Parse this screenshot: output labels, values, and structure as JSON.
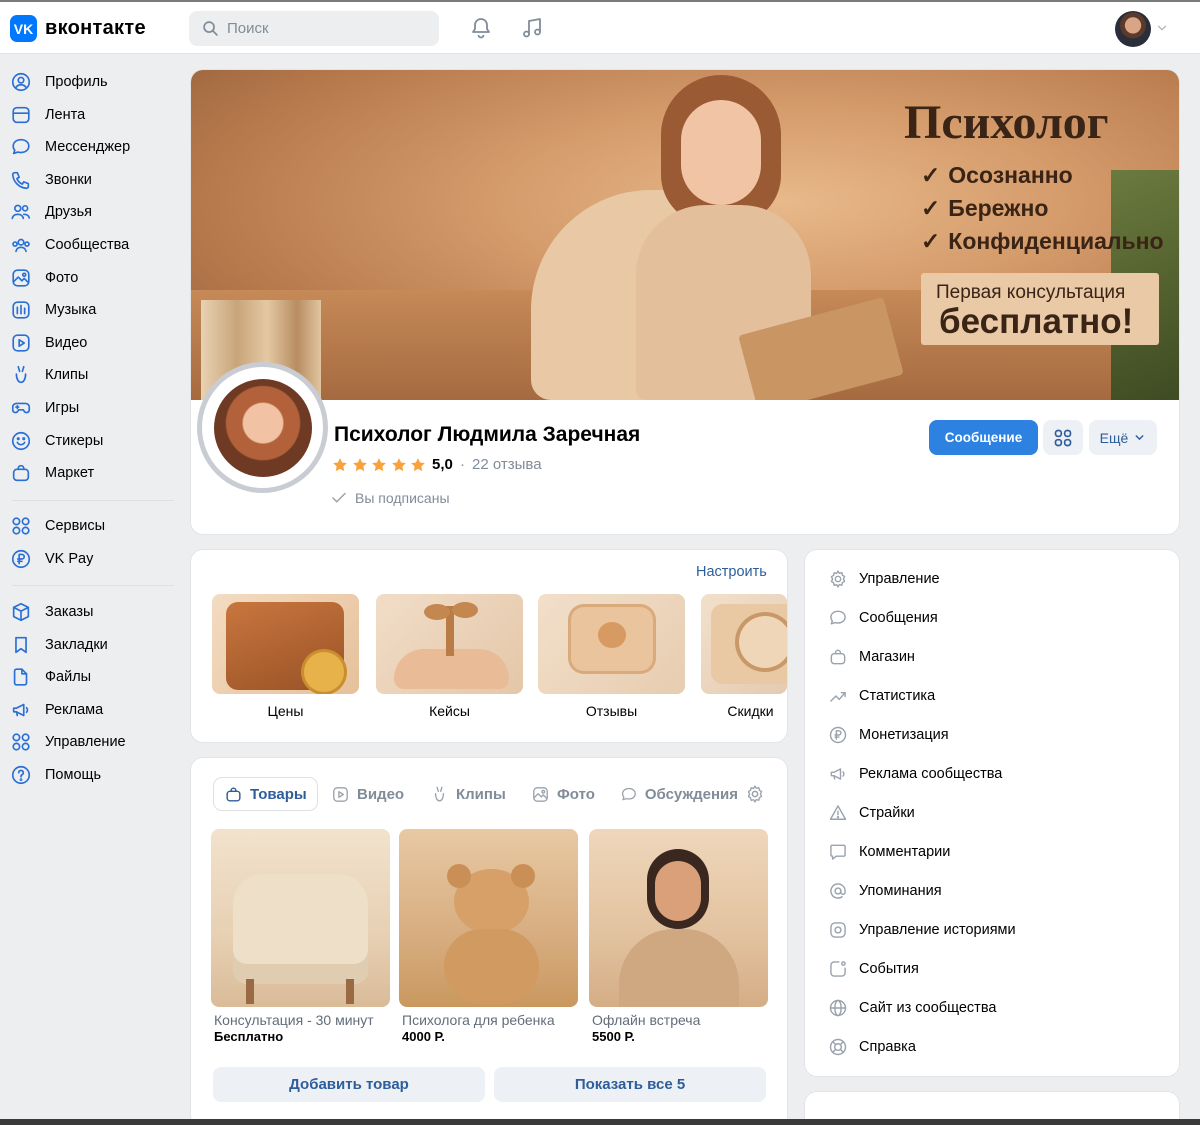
{
  "header": {
    "logo_mark": "VK",
    "logo_text": "вконтакте",
    "search_placeholder": "Поиск",
    "icons": [
      "search-icon",
      "bell-icon",
      "music-note-icon",
      "chevron-down-icon"
    ]
  },
  "sidebar": {
    "items": [
      {
        "label": "Профиль",
        "icon": "user-circle-icon"
      },
      {
        "label": "Лента",
        "icon": "feed-icon"
      },
      {
        "label": "Мессенджер",
        "icon": "chat-bubble-icon"
      },
      {
        "label": "Звонки",
        "icon": "phone-icon"
      },
      {
        "label": "Друзья",
        "icon": "friends-icon"
      },
      {
        "label": "Сообщества",
        "icon": "communities-icon"
      },
      {
        "label": "Фото",
        "icon": "photo-icon"
      },
      {
        "label": "Музыка",
        "icon": "music-icon"
      },
      {
        "label": "Видео",
        "icon": "video-icon"
      },
      {
        "label": "Клипы",
        "icon": "clips-icon"
      },
      {
        "label": "Игры",
        "icon": "gamepad-icon"
      },
      {
        "label": "Стикеры",
        "icon": "smile-icon"
      },
      {
        "label": "Маркет",
        "icon": "bag-icon"
      }
    ],
    "items2": [
      {
        "label": "Сервисы",
        "icon": "grid-icon"
      },
      {
        "label": "VK Pay",
        "icon": "ruble-circle-icon"
      }
    ],
    "items3": [
      {
        "label": "Заказы",
        "icon": "box-icon"
      },
      {
        "label": "Закладки",
        "icon": "bookmark-icon"
      },
      {
        "label": "Файлы",
        "icon": "file-icon"
      },
      {
        "label": "Реклама",
        "icon": "megaphone-icon"
      },
      {
        "label": "Управление",
        "icon": "grid-icon"
      },
      {
        "label": "Помощь",
        "icon": "question-circle-icon"
      }
    ]
  },
  "cover": {
    "title": "Психолог",
    "checks": [
      "Осознанно",
      "Бережно",
      "Конфиденциально"
    ],
    "promo_line1": "Первая консультация",
    "promo_line2": "бесплатно!"
  },
  "profile": {
    "name": "Психолог Людмила Заречная",
    "rating": "5,0",
    "rating_stars": 5,
    "separator": "·",
    "reviews": "22 отзыва",
    "subscribed": "Вы подписаны",
    "message_button": "Сообщение",
    "more_button": "Ещё",
    "colors": {
      "primary": "#2d81e0",
      "star": "#f9a23c",
      "link": "#2d5d9b"
    }
  },
  "tiles": {
    "configure": "Настроить",
    "items": [
      {
        "label": "Цены",
        "icon": "wallet-icon"
      },
      {
        "label": "Кейсы",
        "icon": "sprout-hand-icon"
      },
      {
        "label": "Отзывы",
        "icon": "heart-bubble-icon"
      },
      {
        "label": "Скидки",
        "icon": "percent-tag-icon"
      }
    ]
  },
  "products": {
    "tabs": [
      {
        "label": "Товары",
        "icon": "bag-icon",
        "active": true
      },
      {
        "label": "Видео",
        "icon": "video-icon",
        "active": false
      },
      {
        "label": "Клипы",
        "icon": "clips-icon",
        "active": false
      },
      {
        "label": "Фото",
        "icon": "photo-icon",
        "active": false
      },
      {
        "label": "Обсуждения",
        "icon": "chat-bubble-icon",
        "active": false
      }
    ],
    "items": [
      {
        "name": "Консультация - 30 минут",
        "price": "Бесплатно"
      },
      {
        "name": "Психолога для ребенка",
        "price": "4000 Р."
      },
      {
        "name": "Офлайн встреча",
        "price": "5500 Р."
      }
    ],
    "add_button": "Добавить товар",
    "show_all_button": "Показать все 5"
  },
  "menu": {
    "items": [
      {
        "label": "Управление",
        "icon": "gear-icon"
      },
      {
        "label": "Сообщения",
        "icon": "chat-bubble-icon"
      },
      {
        "label": "Магазин",
        "icon": "bag-icon"
      },
      {
        "label": "Статистика",
        "icon": "trend-icon"
      },
      {
        "label": "Монетизация",
        "icon": "ruble-circle-icon"
      },
      {
        "label": "Реклама сообщества",
        "icon": "megaphone-icon"
      },
      {
        "label": "Страйки",
        "icon": "warning-icon"
      },
      {
        "label": "Комментарии",
        "icon": "comment-icon"
      },
      {
        "label": "Упоминания",
        "icon": "at-icon"
      },
      {
        "label": "Управление историями",
        "icon": "story-icon"
      },
      {
        "label": "События",
        "icon": "event-icon"
      },
      {
        "label": "Сайт из сообщества",
        "icon": "globe-icon"
      },
      {
        "label": "Справка",
        "icon": "lifebuoy-icon"
      }
    ]
  }
}
